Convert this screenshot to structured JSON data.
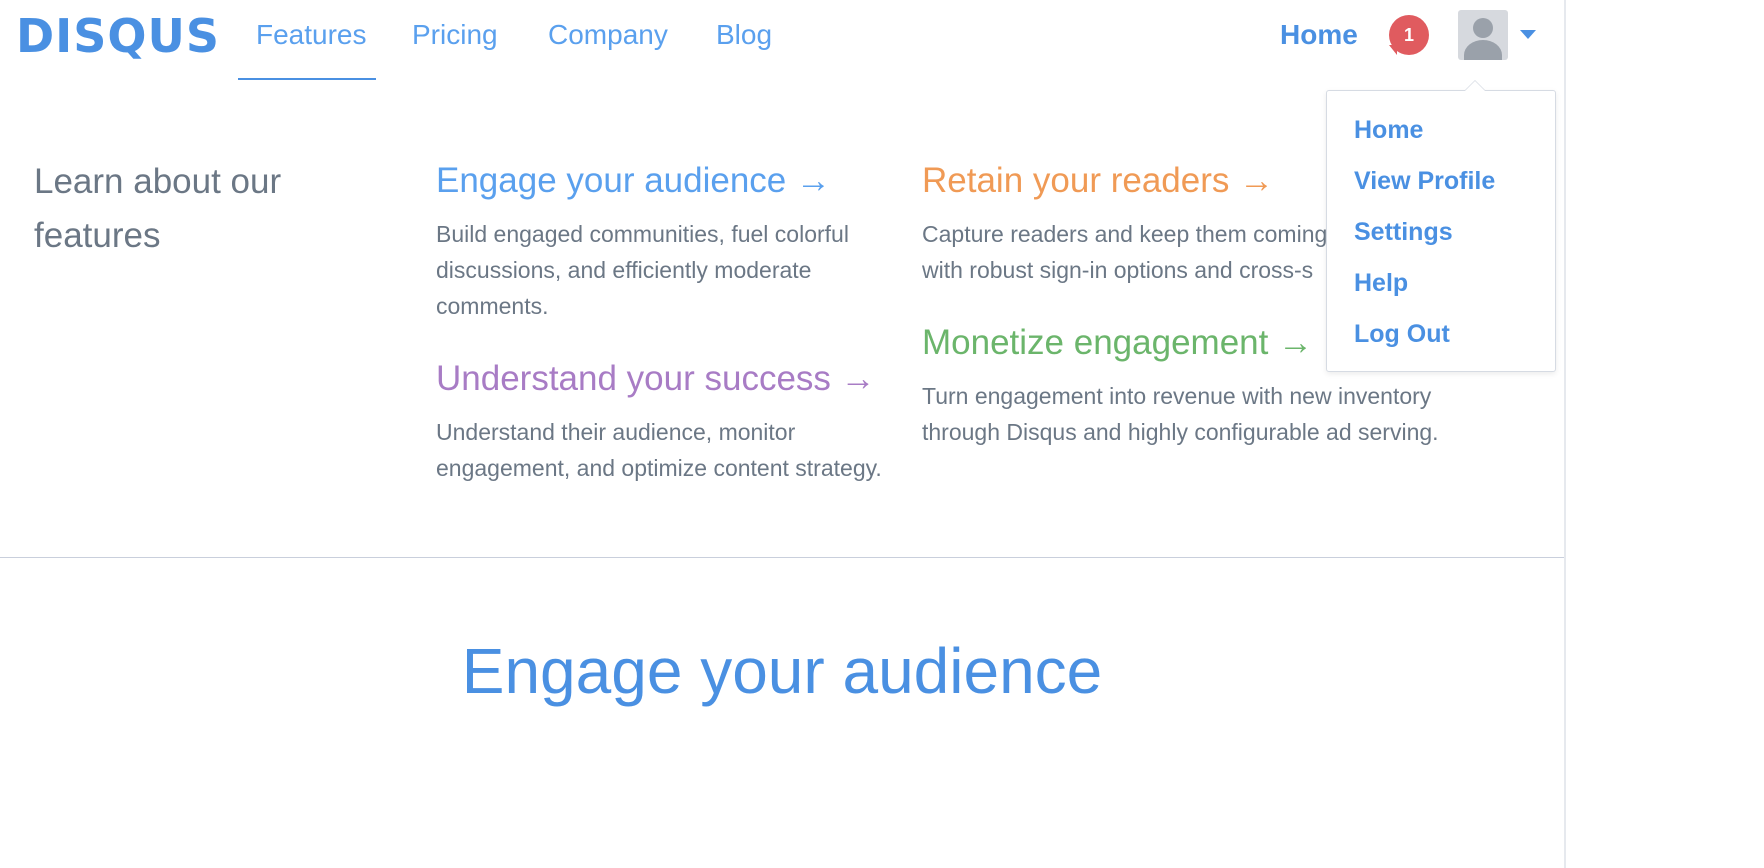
{
  "header": {
    "logo": "DISQUS",
    "nav": [
      "Features",
      "Pricing",
      "Company",
      "Blog"
    ],
    "home": "Home",
    "notifications": "1"
  },
  "intro": "Learn about our features",
  "features": {
    "engage": {
      "title": "Engage your audience →",
      "desc": "Build engaged communities, fuel colorful discussions, and efficiently moderate comments."
    },
    "understand": {
      "title": "Understand your success →",
      "desc": "Understand their audience, monitor engagement, and optimize content strategy."
    },
    "retain": {
      "title": "Retain your readers →",
      "desc": "Capture readers and keep them coming with robust sign-in options and cross-s"
    },
    "monetize": {
      "title": "Monetize engagement →",
      "desc": "Turn engagement into revenue with new inventory through Disqus and highly configurable ad serving."
    }
  },
  "hero": "Engage your audience",
  "dropdown": [
    "Home",
    "View Profile",
    "Settings",
    "Help",
    "Log Out"
  ],
  "colors": {
    "blue": "#4a90e2",
    "orange": "#f09a55",
    "purple": "#a87cc5",
    "green": "#6bb56b",
    "badge": "#e05b5f"
  }
}
